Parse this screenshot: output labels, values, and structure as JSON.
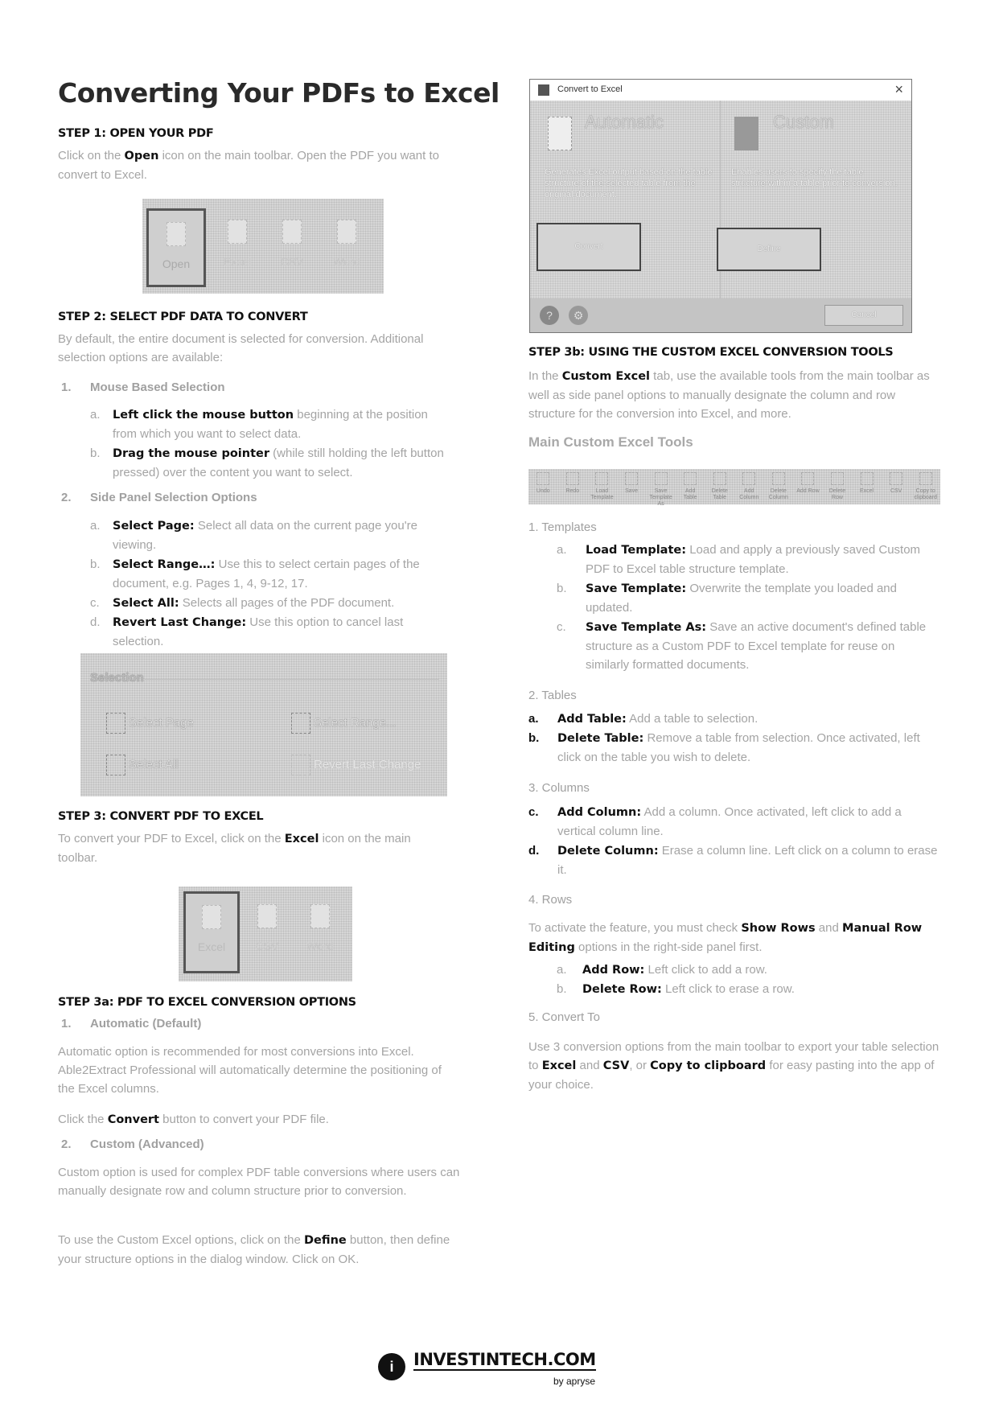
{
  "title": "Converting Your PDFs to Excel",
  "step1": {
    "heading": "STEP 1: OPEN YOUR PDF",
    "text_pre": "Click on the ",
    "text_bold": "Open",
    "text_post": " icon on the main toolbar. Open the PDF you want to convert to Excel.",
    "toolbar": [
      {
        "label": "Open",
        "icon": "folder-open-icon",
        "selected": true
      },
      {
        "label": "Excel",
        "icon": "excel-file-icon",
        "selected": false
      },
      {
        "label": "CSV",
        "icon": "csv-file-icon",
        "selected": false
      },
      {
        "label": "Word",
        "icon": "word-file-icon",
        "selected": false
      }
    ]
  },
  "step2": {
    "heading": "STEP 2: SELECT PDF DATA TO CONVERT",
    "intro": "By default, the entire document is selected for conversion. Additional selection options are available:",
    "sections": [
      {
        "num": "1.",
        "title": "Mouse Based Selection",
        "items": [
          {
            "marker": "a.",
            "bold": "Left click the mouse button",
            "text": " beginning at the position from which you want to select data."
          },
          {
            "marker": "b.",
            "bold": "Drag the mouse pointer",
            "text": " (while still holding the left button pressed) over the content you want to select."
          }
        ]
      },
      {
        "num": "2.",
        "title": "Side Panel Selection Options",
        "items": [
          {
            "marker": "a.",
            "bold": "Select Page:",
            "text": " Select all data on the current page you're viewing."
          },
          {
            "marker": "b.",
            "bold": "Select Range…:",
            "text": " Use this to select certain pages of the document, e.g. Pages 1, 4, 9-12, 17."
          },
          {
            "marker": "c.",
            "bold": "Select All:",
            "text": " Selects all pages of the PDF document."
          },
          {
            "marker": "d.",
            "bold": "Revert Last Change:",
            "text": " Use this option to cancel last selection."
          }
        ]
      }
    ],
    "selection_panel": {
      "title": "Selection",
      "options": [
        {
          "label": "Select Page",
          "icon": "page-icon",
          "enabled": true
        },
        {
          "label": "Select Range...",
          "icon": "range-icon",
          "enabled": true
        },
        {
          "label": "Select All",
          "icon": "checkmark-icon",
          "enabled": true
        },
        {
          "label": "Revert Last Change",
          "icon": "revert-icon",
          "enabled": false
        }
      ]
    }
  },
  "step3": {
    "heading": "STEP 3: CONVERT PDF TO EXCEL",
    "text_pre": "To convert your PDF to Excel, click on the ",
    "text_bold": "Excel",
    "text_post": " icon on the main toolbar.",
    "toolbar": [
      {
        "label": "Excel",
        "selected": true
      },
      {
        "label": "CSV",
        "selected": false
      },
      {
        "label": "Word",
        "selected": false
      }
    ]
  },
  "step3a": {
    "heading": "STEP 3a: PDF TO EXCEL CONVERSION OPTIONS",
    "auto_num": "1.",
    "auto_title": "Automatic (Default)",
    "auto_text": "Automatic option is recommended for most conversions into Excel. Able2Extract Professional will automatically determine the positioning of the Excel columns.",
    "convert_pre": "Click the ",
    "convert_bold": "Convert",
    "convert_post": " button to convert your PDF file.",
    "custom_num": "2.",
    "custom_title": "Custom (Advanced)",
    "custom_text": "Custom option is used for complex PDF table conversions where users can manually designate row and column structure prior to conversion.",
    "define_pre": "To use the Custom Excel options, click on the ",
    "define_bold": "Define",
    "define_post": " button, then define your structure options in the dialog window.  Click on OK."
  },
  "dialog": {
    "title": "Convert to Excel",
    "close": "×",
    "automatic": {
      "title": "Automatic",
      "desc": "Generates Excel output based on the table structure of the selected table from the original document.",
      "button": "Convert"
    },
    "custom": {
      "title": "Custom",
      "desc": "Enables users to specify the table structure within a table prior to conversion.",
      "button": "Define"
    },
    "help_icon": "?",
    "settings_icon": "⚙",
    "cancel": "Cancel"
  },
  "step3b": {
    "heading": "STEP 3b: USING THE CUSTOM EXCEL CONVERSION TOOLS",
    "text_pre": "In the ",
    "text_bold": "Custom Excel",
    "text_post": " tab, use the available tools from the main toolbar as well as side panel options to manually designate the column and row structure for the conversion into Excel, and more.",
    "tools_title": "Main Custom Excel Tools",
    "tools": [
      "Undo",
      "Redo",
      "Load Template",
      "Save",
      "Save Template As",
      "Add Table",
      "Delete Table",
      "Add Column",
      "Delete Column",
      "Add Row",
      "Delete Row",
      "Excel",
      "CSV",
      "Copy to clipboard"
    ],
    "templates": {
      "title": "1. Templates",
      "items": [
        {
          "marker": "a.",
          "bold": "Load Template:",
          "text": " Load and apply a previously saved Custom PDF to Excel table structure template."
        },
        {
          "marker": "b.",
          "bold": "Save Template:",
          "text": " Overwrite the template you loaded and updated."
        },
        {
          "marker": "c.",
          "bold": "Save Template As:",
          "text": " Save an active document's defined table structure as a Custom PDF to Excel template for reuse on similarly formatted documents."
        }
      ]
    },
    "tables": {
      "title": "2. Tables",
      "items": [
        {
          "marker": "a.",
          "bold": "Add Table:",
          "text": " Add a table to selection."
        },
        {
          "marker": "b.",
          "bold": "Delete Table:",
          "text": " Remove a table from selection. Once activated, left click on the table you wish to delete."
        }
      ]
    },
    "columns": {
      "title": "3. Columns",
      "items": [
        {
          "marker": "c.",
          "bold": "Add Column:",
          "text": " Add a column. Once activated, left click to add a vertical column line."
        },
        {
          "marker": "d.",
          "bold": "Delete Column:",
          "text": " Erase a column line. Left click on a column to erase it."
        }
      ]
    },
    "rows": {
      "title": "4. Rows",
      "intro_pre": "To activate the feature, you must check ",
      "intro_b1": "Show Rows",
      "intro_mid": " and ",
      "intro_b2": "Manual Row Editing",
      "intro_post": " options in the right-side panel first.",
      "items": [
        {
          "marker": "a.",
          "bold": "Add Row:",
          "text": " Left click to add a row."
        },
        {
          "marker": "b.",
          "bold": "Delete Row:",
          "text": " Left click to erase a row."
        }
      ]
    },
    "convert_to": {
      "title": "5. Convert To",
      "pre": "Use 3 conversion options from the main toolbar to export your table selection to ",
      "b1": "Excel",
      "mid1": " and ",
      "b2": "CSV",
      "mid2": ", or ",
      "b3": "Copy to clipboard",
      "post": " for easy pasting into the app of your choice."
    }
  },
  "footer": {
    "brand": "INVESTINTECH.COM",
    "by": "by apryse",
    "logo": "i"
  }
}
